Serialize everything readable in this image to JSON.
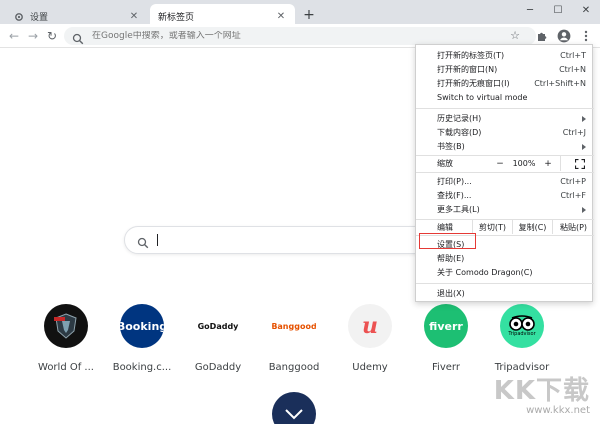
{
  "tabs": {
    "inactive": {
      "title": "设置"
    },
    "active": {
      "title": "新标签页"
    }
  },
  "omnibox": {
    "placeholder": "在Google中搜索，或者输入一个网址"
  },
  "menu": {
    "items_top": [
      {
        "label": "打开新的标签页(T)",
        "shortcut": "Ctrl+T"
      },
      {
        "label": "打开新的窗口(N)",
        "shortcut": "Ctrl+N"
      },
      {
        "label": "打开新的无痕窗口(I)",
        "shortcut": "Ctrl+Shift+N"
      },
      {
        "label": "Switch to virtual mode",
        "shortcut": ""
      }
    ],
    "items_history": [
      {
        "label": "历史记录(H)"
      },
      {
        "label": "下载内容(D)",
        "shortcut": "Ctrl+J"
      },
      {
        "label": "书签(B)"
      }
    ],
    "zoom": {
      "label": "缩放",
      "minus": "−",
      "value": "100%",
      "plus": "+"
    },
    "items_print": [
      {
        "label": "打印(P)...",
        "shortcut": "Ctrl+P"
      },
      {
        "label": "查找(F)...",
        "shortcut": "Ctrl+F"
      },
      {
        "label": "更多工具(L)"
      }
    ],
    "edit": {
      "label": "编辑",
      "cut": "剪切(T)",
      "copy": "复制(C)",
      "paste": "粘贴(P)"
    },
    "items_settings": [
      {
        "label": "设置(S)"
      },
      {
        "label": "帮助(E)"
      },
      {
        "label": "关于 Comodo Dragon(C)"
      }
    ],
    "exit": {
      "label": "退出(X)"
    }
  },
  "shortcuts": [
    {
      "label": "World Of ...",
      "color": "#111111"
    },
    {
      "label": "Booking.c...",
      "color": "#003580",
      "logo": "Booking"
    },
    {
      "label": "GoDaddy",
      "color": "#ffffff",
      "logo": "GoDaddy"
    },
    {
      "label": "Banggood",
      "color": "#ffffff",
      "logo": "Banggood"
    },
    {
      "label": "Udemy",
      "color": "#f2f2f2",
      "logo": "u"
    },
    {
      "label": "Fiverr",
      "color": "#1dbf73",
      "logo": "fiverr"
    },
    {
      "label": "Tripadvisor",
      "color": "#34e0a1",
      "logo": "Tripadvisor"
    }
  ],
  "watermark": {
    "logo": "KK下载",
    "url": "www.kkx.net"
  },
  "colors": {
    "highlight": "#e53935",
    "tabstrip": "#dee1e6",
    "booking": "#003580",
    "fiverr": "#1dbf73",
    "tripadvisor": "#34e0a1",
    "udemy_red": "#ec5252"
  }
}
